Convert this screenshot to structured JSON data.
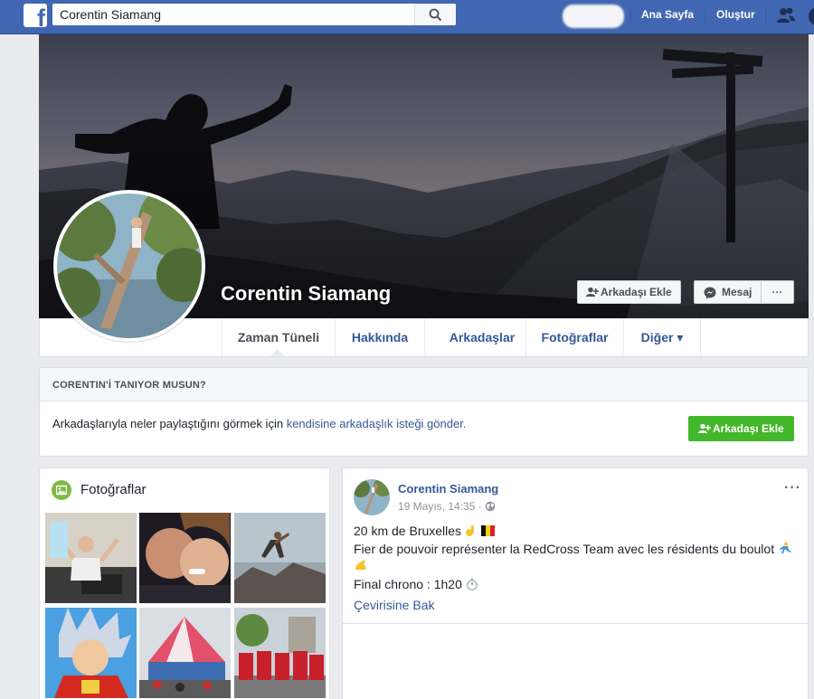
{
  "topbar": {
    "logo": "f",
    "search_value": "Corentin Siamang",
    "home_label": "Ana Sayfa",
    "create_label": "Oluştur"
  },
  "profile": {
    "name": "Corentin Siamang",
    "add_friend_label": "Arkadaşı Ekle",
    "message_label": "Mesaj",
    "more_label": "···"
  },
  "tabs": [
    {
      "label": "Zaman Tüneli",
      "active": true
    },
    {
      "label": "Hakkında"
    },
    {
      "label": "Arkadaşlar"
    },
    {
      "label": "Fotoğraflar"
    },
    {
      "label": "Diğer ▾"
    }
  ],
  "know": {
    "title": "CORENTIN'İ TANIYOR MUSUN?",
    "text_prefix": "Arkadaşlarıyla neler paylaştığını görmek için ",
    "text_link": "kendisine arkadaşlık isteği gönder.",
    "button_label": "Arkadaşı Ekle"
  },
  "photos": {
    "title": "Fotoğraflar"
  },
  "post": {
    "author": "Corentin Siamang",
    "time": "19 Mayıs, 14:35 ·",
    "more": "···",
    "line1": "20 km de Bruxelles",
    "line2": "Fier de pouvoir représenter la RedCross Team avec les résidents du boulot",
    "line4": "Final chrono : 1h20",
    "translate": "Çevirisine Bak"
  },
  "colors": {
    "brand_blue": "#4267b2",
    "link_blue": "#365899",
    "green": "#42b72a",
    "bg": "#e9ebee"
  }
}
